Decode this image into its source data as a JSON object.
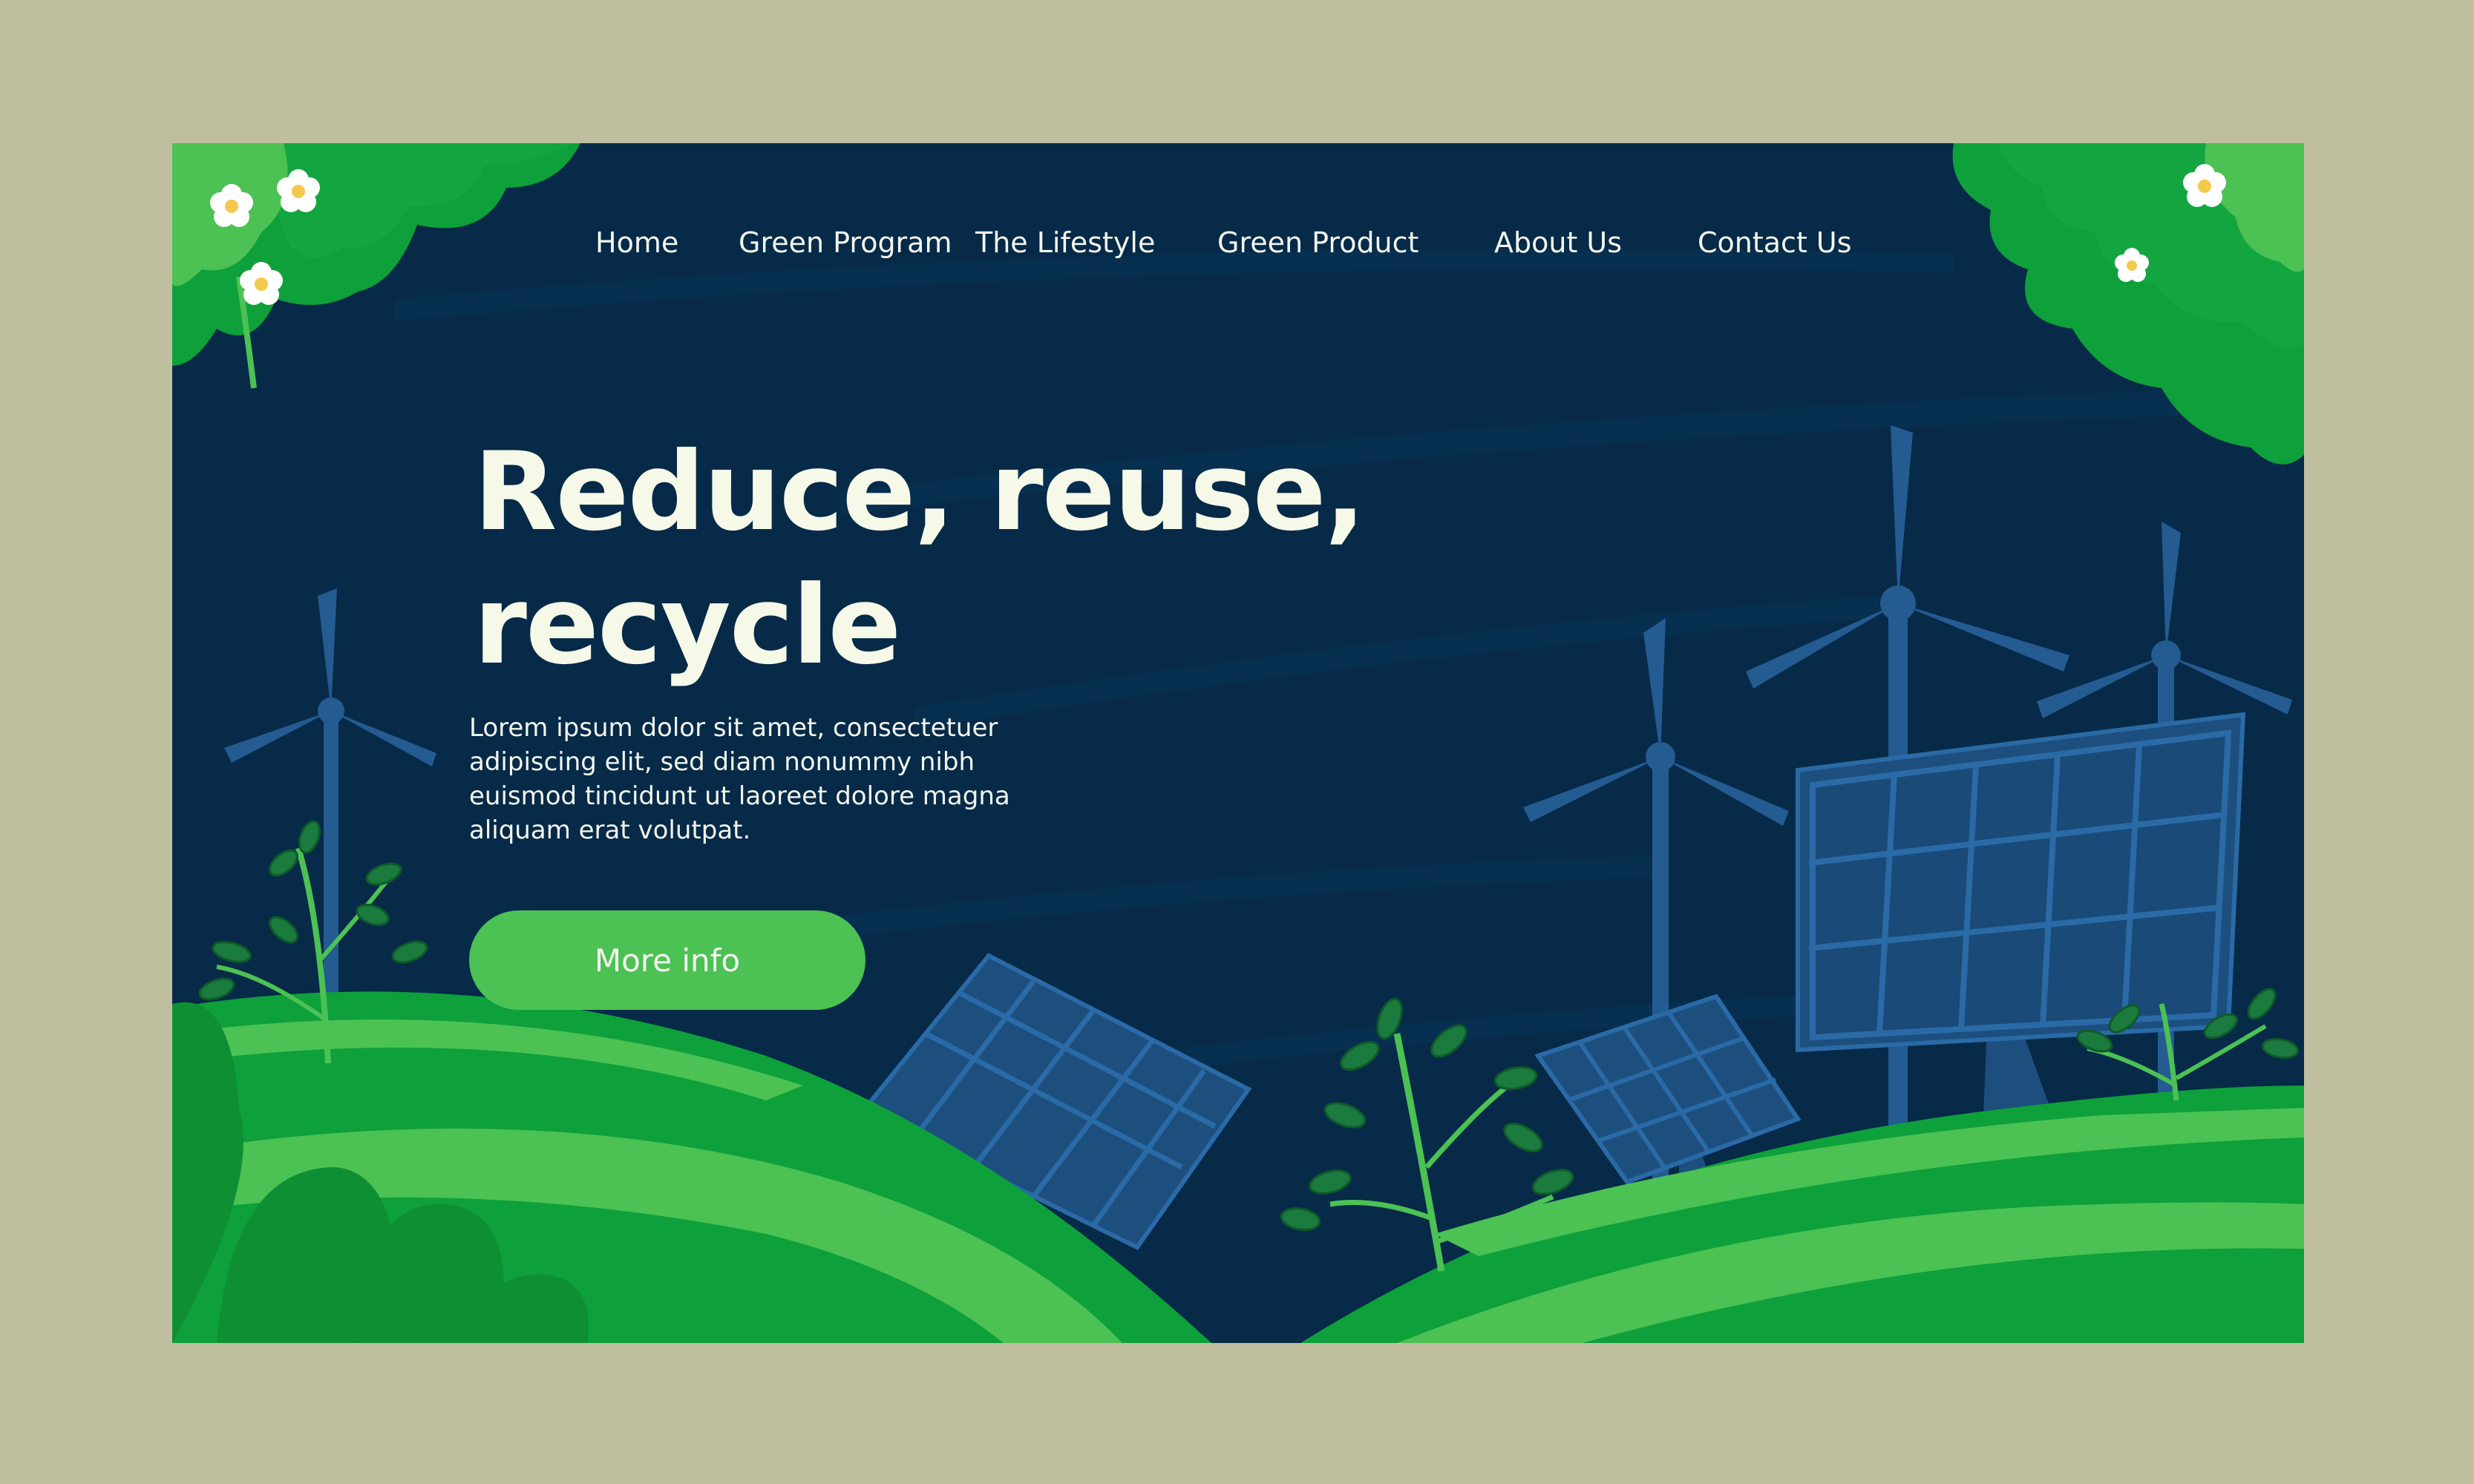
{
  "nav": {
    "items": [
      {
        "label": "Home"
      },
      {
        "label": "Green Program"
      },
      {
        "label": "The Lifestyle"
      },
      {
        "label": "Green Product"
      },
      {
        "label": "About Us"
      },
      {
        "label": "Contact Us"
      }
    ]
  },
  "hero": {
    "headline_line1": "Reduce, reuse,",
    "headline_line2": "recycle",
    "description": "Lorem ipsum dolor sit amet, consectetuer adipiscing elit, sed diam nonummy nibh euismod tincidunt ut laoreet dolore magna aliquam erat volutpat.",
    "button_label": "More info"
  },
  "colors": {
    "page_background": "#bfbf9f",
    "sky": "#062a48",
    "accent_green": "#4cc154",
    "dark_green": "#0ea03a",
    "solar_panel": "#1d4f7e",
    "text_light": "#f3f6ee"
  }
}
